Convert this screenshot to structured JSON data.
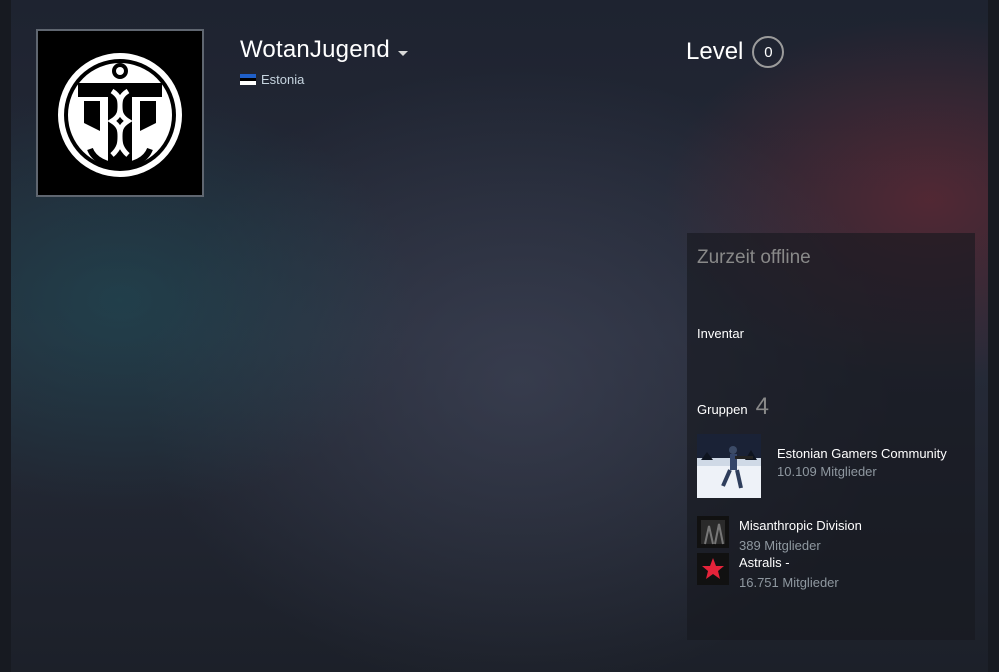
{
  "profile": {
    "persona_name": "WotanJugend",
    "country": "Estonia",
    "level_label": "Level",
    "level_value": "0"
  },
  "sidebar": {
    "status": "Zurzeit offline",
    "inventory_label": "Inventar",
    "groups_label": "Gruppen",
    "groups_count": "4",
    "groups": [
      {
        "name": "Estonian Gamers Community",
        "members": "10.109 Mitglieder"
      },
      {
        "name": "Misanthropic Division",
        "members": "389 Mitglieder"
      },
      {
        "name": "Astralis -",
        "members": "16.751 Mitglieder"
      }
    ]
  },
  "colors": {
    "panel_bg": "#16181e",
    "muted_text": "#898989",
    "member_text": "#8f98a0",
    "astralis_red": "#e5233a"
  },
  "icons": {
    "dropdown": "chevron-down-icon",
    "flag": "estonia-flag-icon"
  }
}
